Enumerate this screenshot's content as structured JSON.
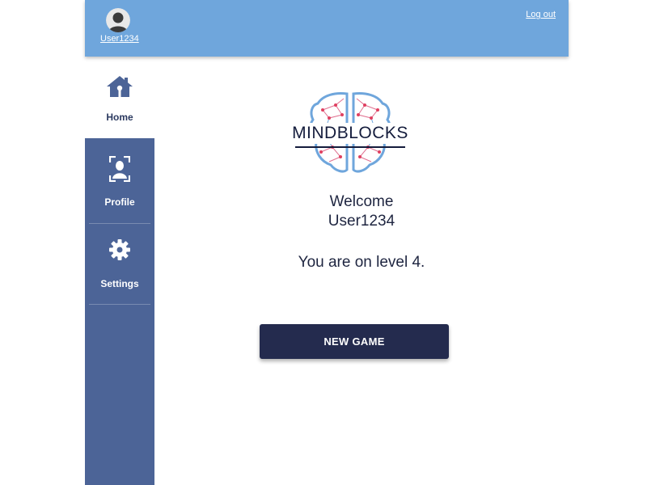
{
  "header": {
    "username": "User1234",
    "logout_label": "Log out",
    "avatar_icon": "user-avatar-icon"
  },
  "sidebar": {
    "items": [
      {
        "label": "Home",
        "icon": "home-icon",
        "active": true
      },
      {
        "label": "Profile",
        "icon": "profile-scan-icon",
        "active": false
      },
      {
        "label": "Settings",
        "icon": "gear-icon",
        "active": false
      }
    ]
  },
  "main": {
    "logo_text": "MINDBLOCKS",
    "welcome_line1": "Welcome",
    "welcome_line2": "User1234",
    "level_text": "You are on level 4.",
    "new_game_label": "NEW GAME"
  },
  "colors": {
    "header_bg": "#6fa6dc",
    "sidebar_bg": "#4c6497",
    "button_bg": "#242b4e",
    "text_dark": "#1e2540"
  }
}
